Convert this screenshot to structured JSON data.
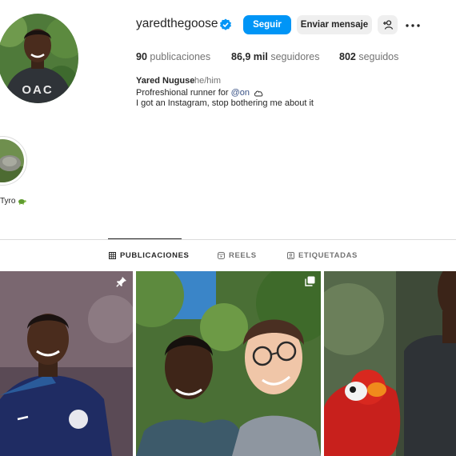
{
  "profile": {
    "username": "yaredthegoose",
    "verified_icon": "verified-badge-icon",
    "follow_label": "Seguir",
    "message_label": "Enviar mensaje",
    "adduser_icon": "add-user-icon",
    "more_icon": "more-options-icon",
    "stats": {
      "posts_count": "90",
      "posts_label": "publicaciones",
      "followers_count": "86,9 mil",
      "followers_label": "seguidores",
      "following_count": "802",
      "following_label": "seguidos"
    },
    "full_name": "Yared Nuguse",
    "pronouns": "he/him",
    "bio_line1_prefix": "Profreshional runner for",
    "bio_mention": "@on",
    "bio_line2": "I got an Instagram, stop bothering me about it"
  },
  "highlights": [
    {
      "label": "Tyro",
      "icon": "turtle-emoji-icon"
    }
  ],
  "tabs": [
    {
      "label": "PUBLICACIONES",
      "icon": "grid-icon",
      "active": true
    },
    {
      "label": "REELS",
      "icon": "reels-icon",
      "active": false
    },
    {
      "label": "ETIQUETADAS",
      "icon": "tagged-icon",
      "active": false
    }
  ],
  "posts": [
    {
      "badge": "pin-icon"
    },
    {
      "badge": "carousel-icon"
    },
    {
      "badge": ""
    }
  ],
  "colors": {
    "accent": "#0095f6",
    "text": "#262626",
    "secondary_text": "#737373",
    "button_gray": "#efefef",
    "divider": "#dbdbdb"
  }
}
